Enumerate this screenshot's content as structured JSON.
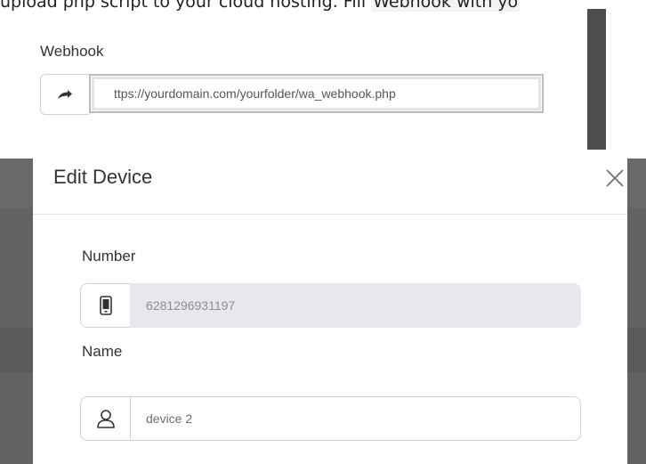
{
  "document": {
    "line_plain": "upload php script to your cloud hosting. Fill ",
    "line_highlight": "Webhook with yo"
  },
  "background_form": {
    "label": "Webhook",
    "icon": "share-arrow-icon",
    "value": "ttps://yourdomain.com/yourfolder/wa_webhook.php"
  },
  "modal": {
    "title": "Edit Device",
    "close_icon": "close-icon",
    "fields": {
      "number": {
        "label": "Number",
        "icon": "phone-icon",
        "value": "6281296931197",
        "readonly": true
      },
      "name": {
        "label": "Name",
        "icon": "user-icon",
        "value": "device 2",
        "readonly": false
      }
    }
  },
  "colors": {
    "backdrop": "#636363",
    "input_border": "#cfd3d8",
    "readonly_bg": "#e6e8eb",
    "text": "#333333"
  }
}
